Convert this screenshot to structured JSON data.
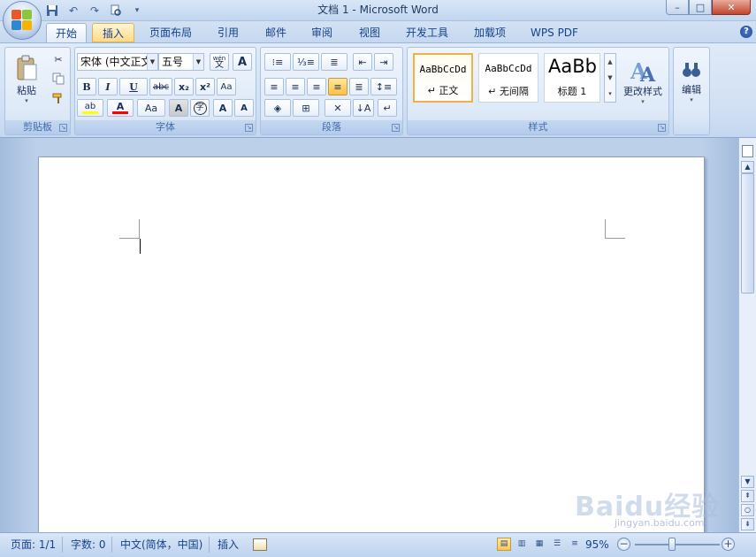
{
  "window": {
    "title": "文档 1 - Microsoft Word",
    "controls": [
      "minimize",
      "maximize",
      "close"
    ]
  },
  "quick_access": [
    "save-icon",
    "undo-icon",
    "redo-icon",
    "print-preview-icon",
    "customize-icon"
  ],
  "tabs": [
    {
      "label": "开始",
      "active": true
    },
    {
      "label": "插入",
      "hover": true
    },
    {
      "label": "页面布局"
    },
    {
      "label": "引用"
    },
    {
      "label": "邮件"
    },
    {
      "label": "审阅"
    },
    {
      "label": "视图"
    },
    {
      "label": "开发工具"
    },
    {
      "label": "加载项"
    },
    {
      "label": "WPS PDF"
    }
  ],
  "ribbon": {
    "clipboard": {
      "label": "剪贴板",
      "paste": "粘贴"
    },
    "font": {
      "label": "字体",
      "font_name": "宋体 (中文正文",
      "font_size": "五号",
      "pinyin": "wén",
      "bold": "B",
      "italic": "I",
      "underline": "U",
      "strike": "abc",
      "subscript": "x₂",
      "superscript": "x²",
      "grow": "A",
      "shrink": "A",
      "case": "Aa",
      "char_border": "A",
      "enclose": "字",
      "font_color": "A",
      "highlight": "ab"
    },
    "paragraph": {
      "label": "段落"
    },
    "styles": {
      "label": "样式",
      "items": [
        {
          "sample": "AaBbCcDd",
          "name": "↵ 正文",
          "selected": true
        },
        {
          "sample": "AaBbCcDd",
          "name": "↵ 无间隔"
        },
        {
          "sample": "AaBb",
          "name": "标题 1"
        }
      ],
      "change_styles": "更改样式"
    },
    "editing": {
      "label": "编辑"
    }
  },
  "status": {
    "page": "页面: 1/1",
    "words": "字数: 0",
    "language": "中文(简体，中国)",
    "mode": "插入",
    "zoom": "95%",
    "zoom_level": 95
  },
  "watermark": {
    "brand": "Baidu经验",
    "url": "jingyan.baidu.com"
  },
  "colors": {
    "font_color": "#ff0000",
    "highlight": "#ffff00",
    "accent": "#15428b"
  }
}
